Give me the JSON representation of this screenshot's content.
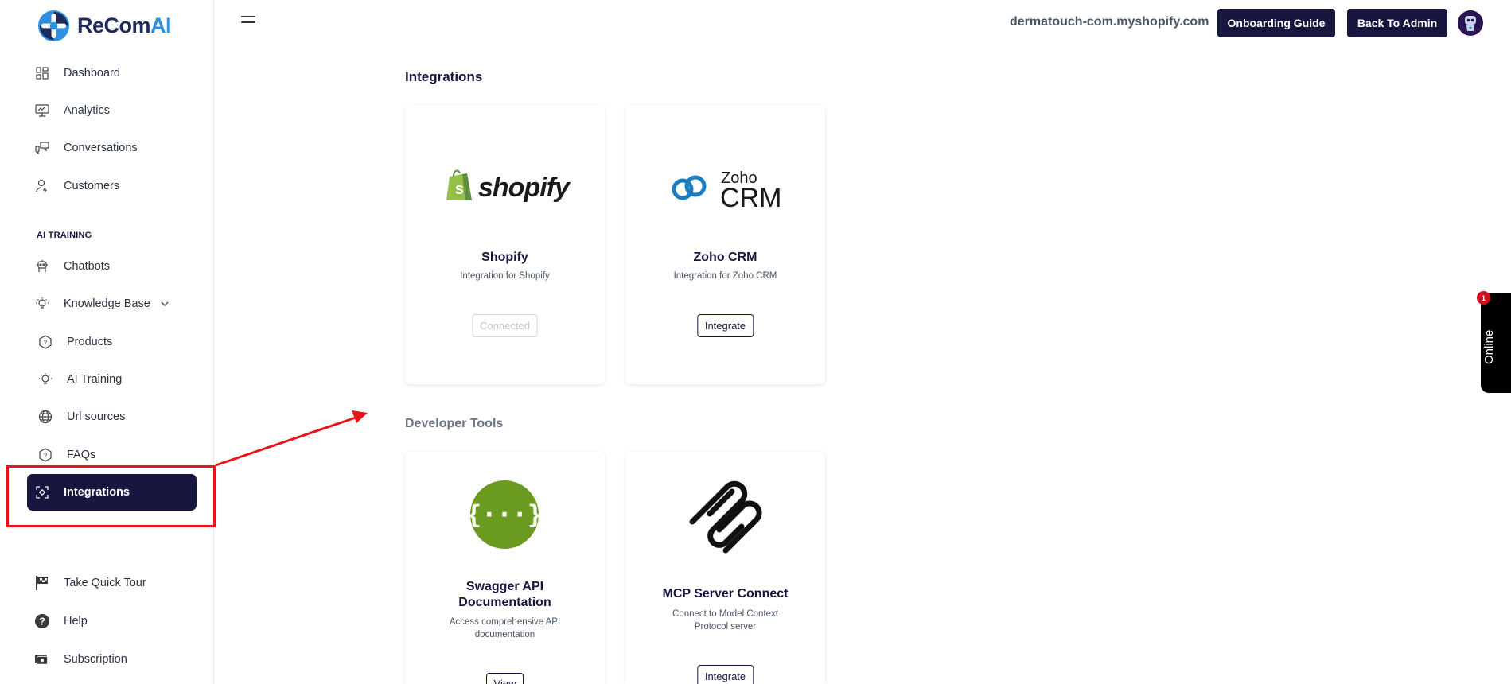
{
  "brand": {
    "name_main": "ReCom",
    "name_accent": "AI"
  },
  "sidebar": {
    "items": [
      {
        "label": "Dashboard",
        "icon": "dashboard-icon"
      },
      {
        "label": "Analytics",
        "icon": "analytics-icon"
      },
      {
        "label": "Conversations",
        "icon": "conversations-icon"
      },
      {
        "label": "Customers",
        "icon": "customers-icon"
      }
    ],
    "section_label": "AI TRAINING",
    "training_items": [
      {
        "label": "Chatbots",
        "icon": "robot-icon"
      },
      {
        "label": "Knowledge Base",
        "icon": "bulb-icon"
      },
      {
        "label": "Products",
        "icon": "hexagon-question-icon"
      },
      {
        "label": "AI Training",
        "icon": "bulb-icon"
      },
      {
        "label": "Url sources",
        "icon": "globe-icon"
      },
      {
        "label": "FAQs",
        "icon": "hexagon-question-icon"
      },
      {
        "label": "Integrations",
        "icon": "integrations-icon",
        "active": true
      }
    ],
    "footer_items": [
      {
        "label": "Take Quick Tour",
        "icon": "flag-icon"
      },
      {
        "label": "Help",
        "icon": "help-icon"
      },
      {
        "label": "Subscription",
        "icon": "subscription-icon"
      }
    ]
  },
  "header": {
    "store_domain": "dermatouch-com.myshopify.com",
    "onboarding_label": "Onboarding Guide",
    "back_label": "Back To Admin"
  },
  "main": {
    "integrations_heading": "Integrations",
    "developer_heading": "Developer Tools",
    "integration_cards": [
      {
        "title": "Shopify",
        "desc": "Integration for Shopify",
        "button": "Connected",
        "logo_text": "shopify"
      },
      {
        "title": "Zoho CRM",
        "desc": "Integration for Zoho CRM",
        "button": "Integrate",
        "logo_text_top": "Zoho",
        "logo_text_bottom": "CRM"
      }
    ],
    "developer_cards": [
      {
        "title": "Swagger API Documentation",
        "desc": "Access comprehensive API documentation",
        "button": "View",
        "logo_text": "{···}"
      },
      {
        "title": "MCP Server Connect",
        "desc": "Connect to Model Context Protocol server",
        "button": "Integrate"
      }
    ]
  },
  "chat_widget": {
    "label": "Online",
    "badge": "1"
  },
  "colors": {
    "primary": "#16163f",
    "accent": "#2f8fe0",
    "annotation": "#e8141a",
    "shopify_green": "#95bf47",
    "swagger_green": "#6a9a1f",
    "zoho_blue": "#1a7fc1"
  }
}
